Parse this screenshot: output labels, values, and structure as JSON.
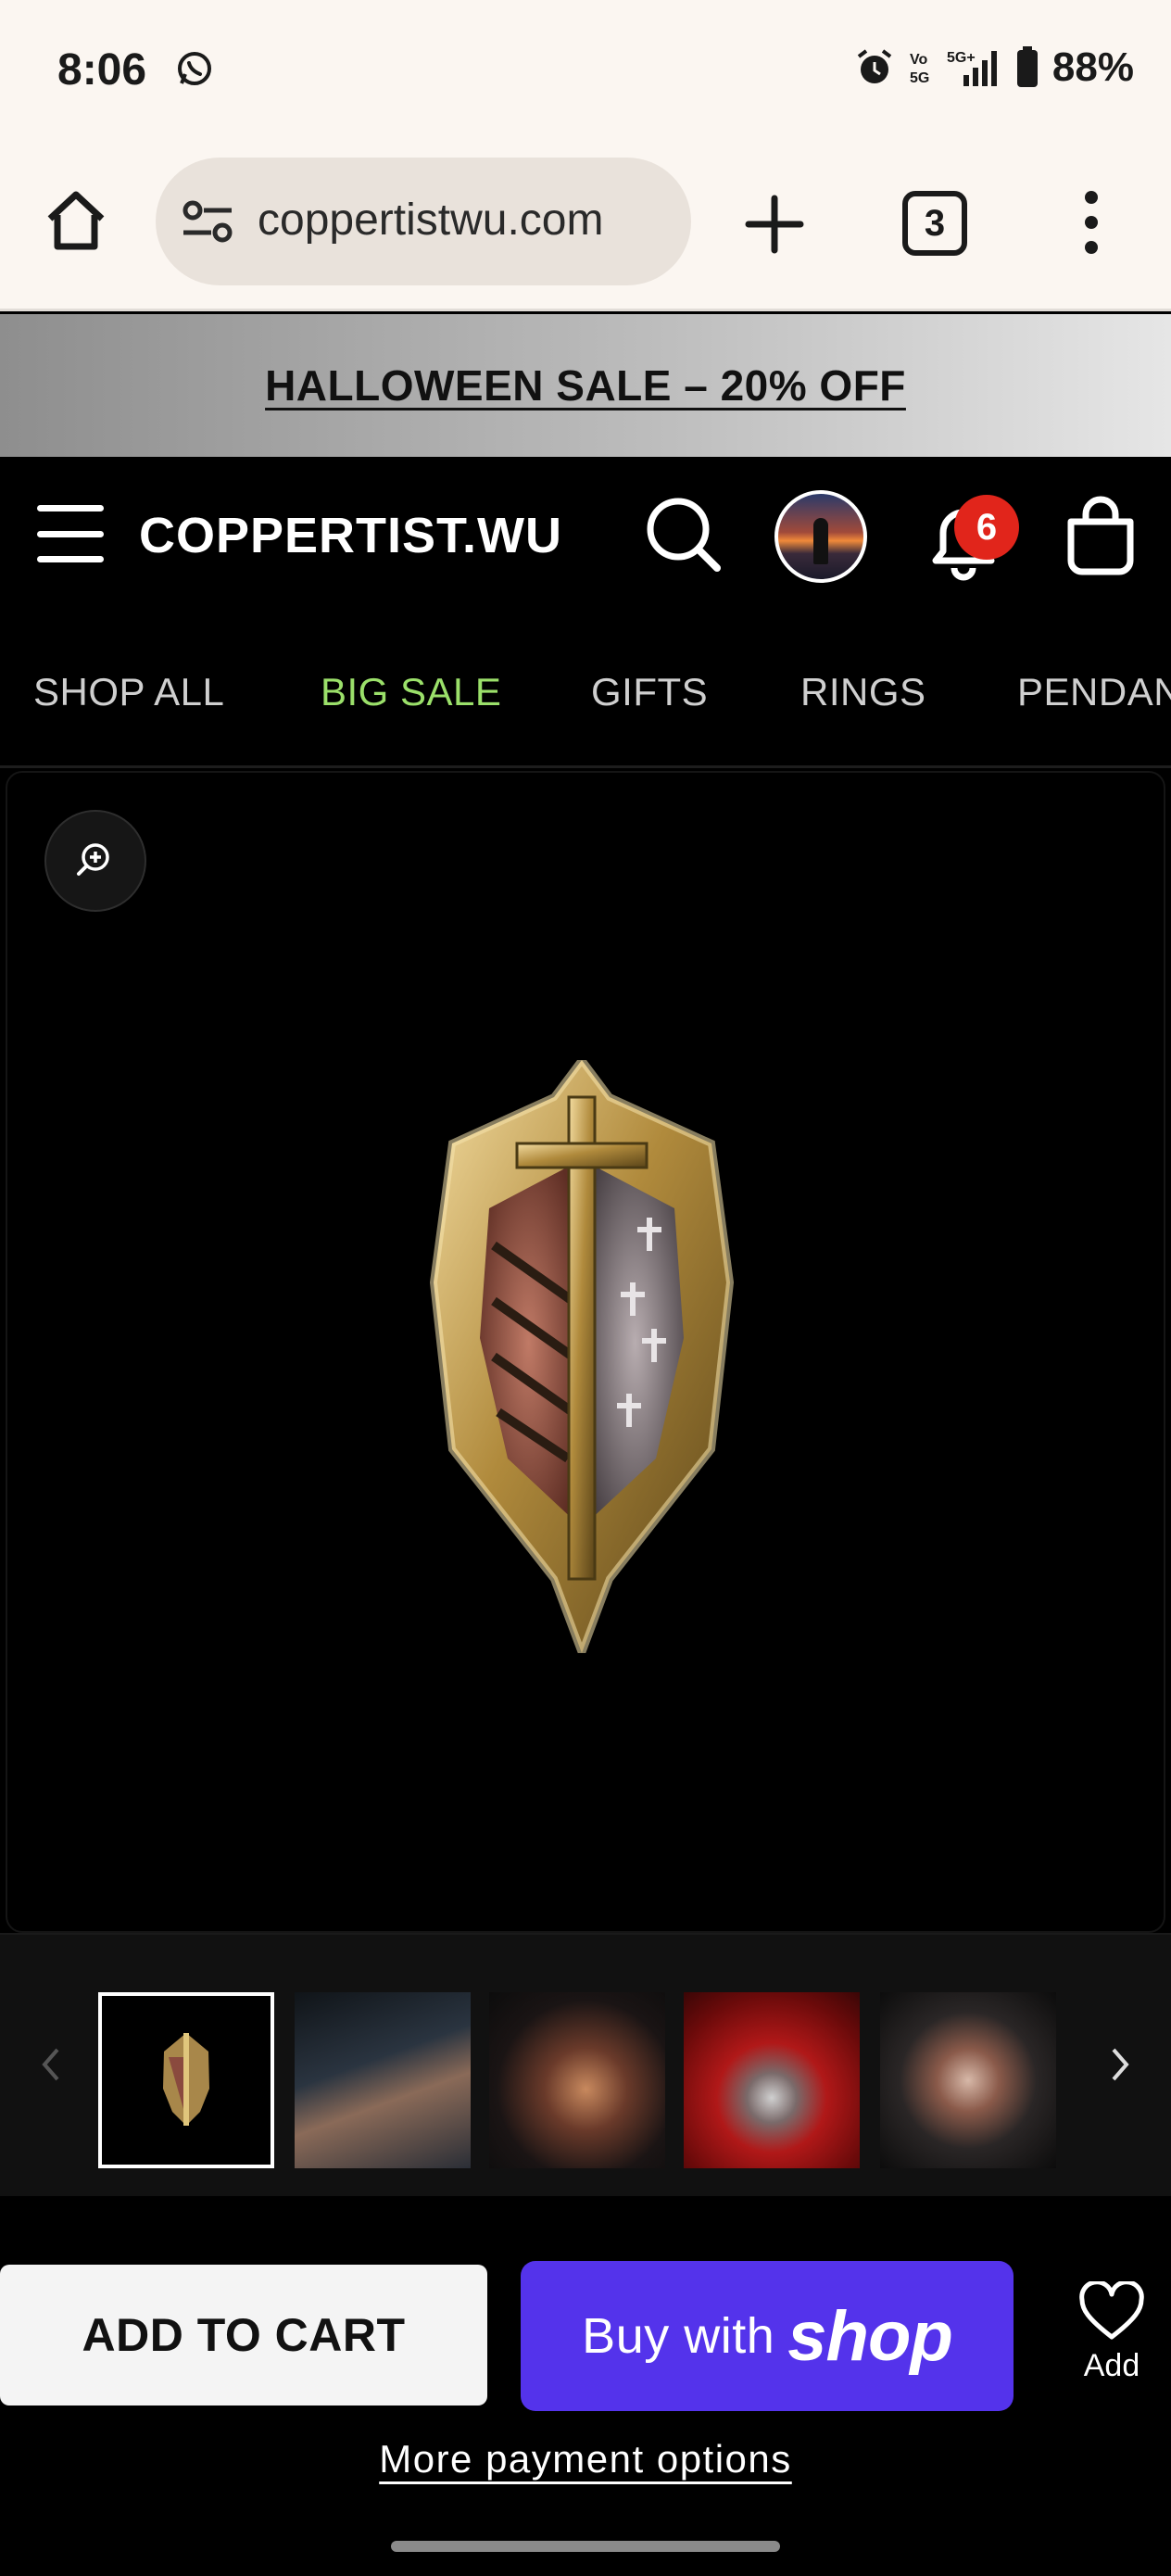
{
  "status_bar": {
    "time": "8:06",
    "battery": "88%",
    "icons": [
      "whatsapp-icon",
      "alarm-icon",
      "volte-icon",
      "5g-signal-icon",
      "battery-icon"
    ]
  },
  "browser": {
    "url": "coppertistwu.com",
    "tab_count": "3",
    "icons": [
      "home-icon",
      "site-settings-icon",
      "new-tab-icon",
      "tab-switcher-icon",
      "overflow-menu-icon"
    ]
  },
  "promo": {
    "text": "HALLOWEEN SALE – 20% OFF"
  },
  "header": {
    "logo": "COPPERTIST.WU",
    "notification_count": "6",
    "icons": [
      "menu-icon",
      "search-icon",
      "avatar",
      "bell-icon",
      "shopping-bag-icon"
    ]
  },
  "nav": {
    "items": [
      {
        "label": "SHOP ALL"
      },
      {
        "label": "BIG SALE"
      },
      {
        "label": "GIFTS"
      },
      {
        "label": "RINGS"
      },
      {
        "label": "PENDAN"
      }
    ]
  },
  "gallery": {
    "active_index": 0,
    "thumbnail_count": 5,
    "icons": [
      "zoom-in-icon",
      "chevron-left-icon",
      "chevron-right-icon"
    ]
  },
  "actions": {
    "add_to_cart": "ADD TO CART",
    "buy_with": "Buy with",
    "shop_brand": "shop",
    "wishlist_label": "Add",
    "more_payment": "More payment options"
  },
  "colors": {
    "shop_purple": "#5433eb",
    "sale_green": "#9be06a",
    "badge_red": "#e1251b"
  }
}
